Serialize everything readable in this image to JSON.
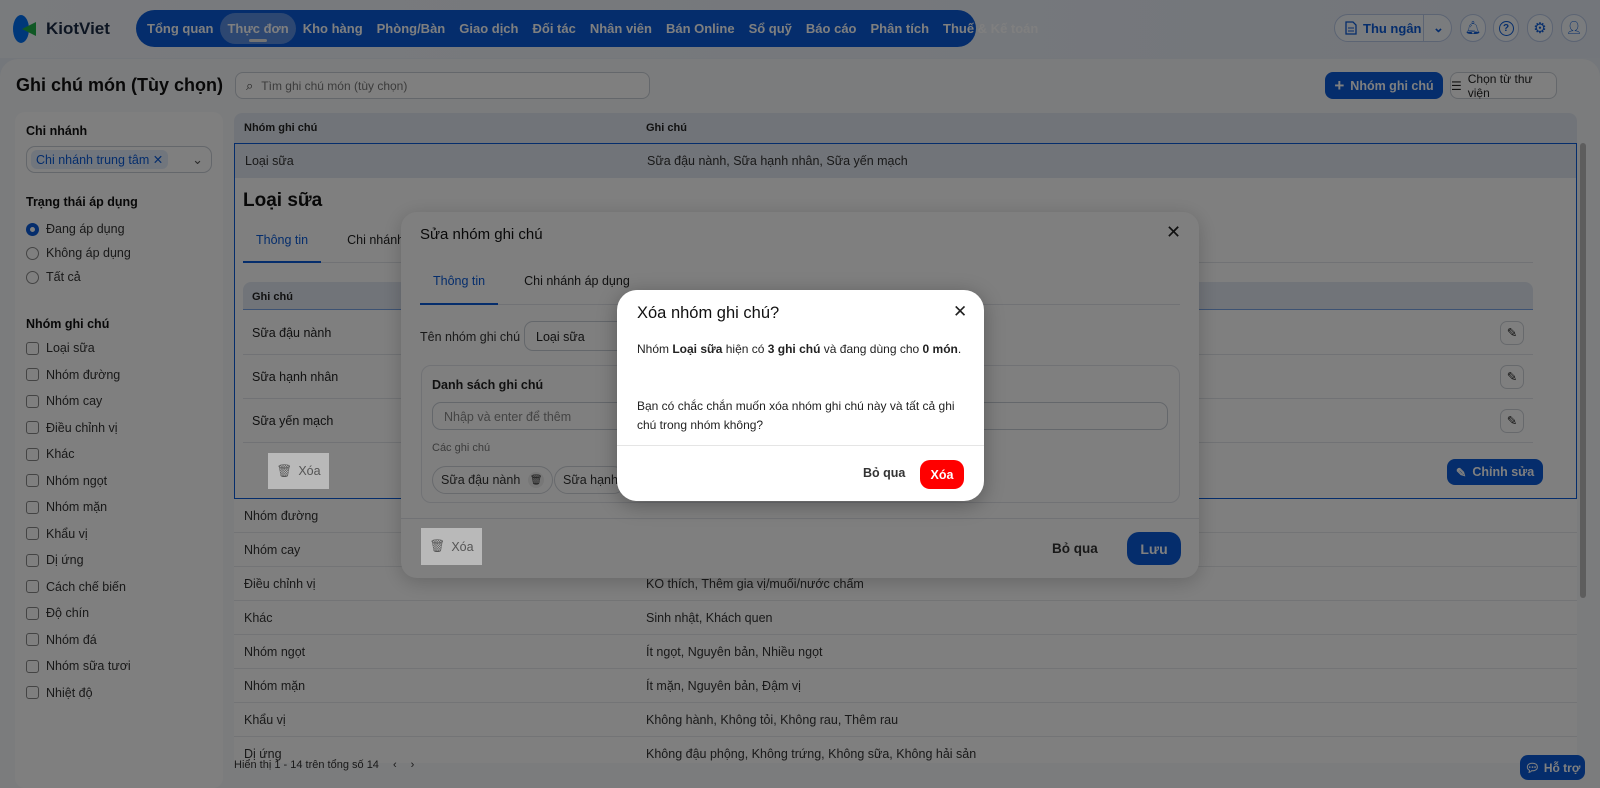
{
  "app": {
    "logo": "KiotViet"
  },
  "nav": {
    "items": [
      "Tổng quan",
      "Thực đơn",
      "Kho hàng",
      "Phòng/Bàn",
      "Giao dịch",
      "Đối tác",
      "Nhân viên",
      "Bán Online",
      "Sổ quỹ",
      "Báo cáo",
      "Phân tích",
      "Thuế & Kế toán"
    ],
    "active": 1
  },
  "header": {
    "cashier": "Thu ngân",
    "icons": [
      "bell-icon",
      "help-icon",
      "gear-icon",
      "user-icon"
    ]
  },
  "page": {
    "title": "Ghi chú món (Tùy chọn)",
    "search_placeholder": "Tìm ghi chú món (tùy chọn)",
    "add_group": "Nhóm ghi chú",
    "library": "Chọn từ thư viện"
  },
  "sidebar": {
    "branch_label": "Chi nhánh",
    "branch_value": "Chi nhánh trung tâm",
    "status_label": "Trạng thái áp dụng",
    "status_options": [
      "Đang áp dụng",
      "Không áp dụng",
      "Tất cả"
    ],
    "status_selected": 0,
    "group_label": "Nhóm ghi chú",
    "groups": [
      "Loại sữa",
      "Nhóm đường",
      "Nhóm cay",
      "Điều chỉnh vị",
      "Khác",
      "Nhóm ngọt",
      "Nhóm mặn",
      "Khẩu vị",
      "Dị ứng",
      "Cách chế biến",
      "Độ chín",
      "Nhóm đá",
      "Nhóm sữa tươi",
      "Nhiệt độ"
    ]
  },
  "table": {
    "headers": [
      "Nhóm ghi chú",
      "Ghi chú"
    ],
    "expanded": {
      "name": "Loại sữa",
      "notes": "Sữa đậu nành, Sữa hạnh nhân, Sữa yến mạch",
      "title": "Loại sữa",
      "tabs": [
        "Thông tin",
        "Chi nhánh"
      ],
      "sub_header": "Ghi chú",
      "sub_rows": [
        "Sữa đậu nành",
        "Sữa hạnh nhân",
        "Sữa yến mạch"
      ],
      "delete": "Xóa",
      "edit": "Chỉnh sửa"
    },
    "rows": [
      {
        "name": "Nhóm đường",
        "notes": ""
      },
      {
        "name": "Nhóm cay",
        "notes": ""
      },
      {
        "name": "Điều chỉnh vị",
        "notes": "KO thích, Thêm gia vị/muối/nước chấm"
      },
      {
        "name": "Khác",
        "notes": "Sinh nhật, Khách quen"
      },
      {
        "name": "Nhóm ngọt",
        "notes": "Ít ngọt, Nguyên bản, Nhiều ngọt"
      },
      {
        "name": "Nhóm mặn",
        "notes": "Ít mặn, Nguyên bản, Đậm vị"
      },
      {
        "name": "Khẩu vị",
        "notes": "Không hành, Không tỏi, Không rau, Thêm rau"
      },
      {
        "name": "Dị ứng",
        "notes": "Không đậu phộng, Không trứng, Không sữa, Không hải sản"
      }
    ],
    "pagination": "Hiển thị 1 - 14 trên tổng số 14"
  },
  "edit_modal": {
    "title": "Sửa nhóm ghi chú",
    "tabs": [
      "Thông tin",
      "Chi nhánh áp dụng"
    ],
    "name_label": "Tên nhóm ghi chú",
    "name_value": "Loại sữa",
    "list_title": "Danh sách ghi chú",
    "input_placeholder": "Nhập và enter để thêm",
    "notes_label": "Các ghi chú",
    "chips": [
      "Sữa đậu nành",
      "Sữa hạnh"
    ],
    "delete": "Xóa",
    "cancel": "Bỏ qua",
    "save": "Lưu"
  },
  "confirm": {
    "title": "Xóa nhóm ghi chú?",
    "p1_a": "Nhóm ",
    "p1_name": "Loại sữa",
    "p1_b": " hiện có ",
    "p1_count": "3 ghi chú",
    "p1_c": " và đang dùng cho ",
    "p1_used": "0 món",
    "p1_d": ".",
    "p2": "Bạn có chắc chắn muốn xóa nhóm ghi chú này và tất cả ghi chú trong nhóm không?",
    "cancel": "Bỏ qua",
    "confirm": "Xóa",
    "danger_color": "#ff0000"
  },
  "help": "Hỗ trợ"
}
